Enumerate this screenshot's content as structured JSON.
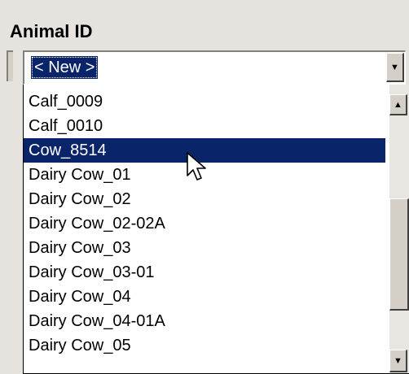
{
  "field": {
    "label": "Animal ID"
  },
  "combo": {
    "value": "< New >",
    "dropdown_icon": "triangle-down-icon"
  },
  "list": {
    "items": [
      "Calf_0009",
      "Calf_0010",
      "Cow_8514",
      "Dairy Cow_01",
      "Dairy Cow_02",
      "Dairy Cow_02-02A",
      "Dairy Cow_03",
      "Dairy Cow_03-01",
      "Dairy Cow_04",
      "Dairy Cow_04-01A",
      "Dairy Cow_05"
    ],
    "selected_index": 2
  },
  "scrollbar": {
    "up_icon": "triangle-up-icon",
    "down_icon": "triangle-down-icon"
  },
  "cursor": {
    "icon": "mouse-pointer-icon"
  },
  "colors": {
    "selection": "#0a246a",
    "selection_text": "#ffffff",
    "face": "#d4d0c8"
  }
}
